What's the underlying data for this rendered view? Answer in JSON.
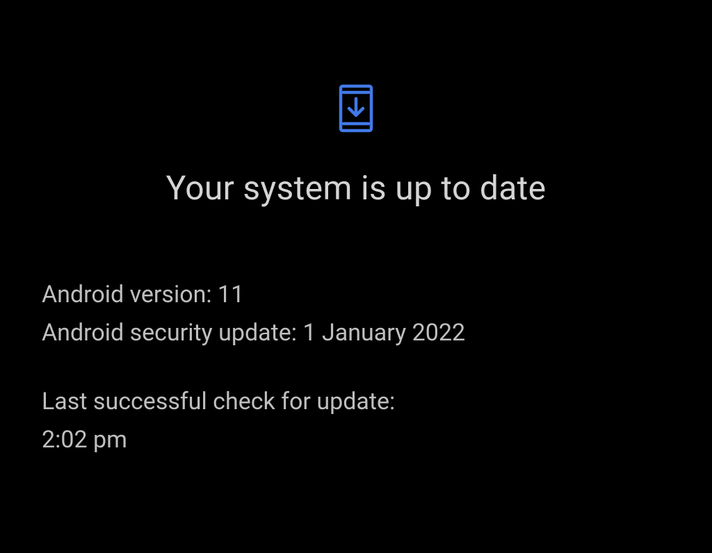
{
  "colors": {
    "accent": "#4179e8",
    "text_primary": "#d4d4d4",
    "text_secondary": "#bfbfbf",
    "background": "#000000"
  },
  "header": {
    "title": "Your system is up to date"
  },
  "details": {
    "android_version_label": "Android version: ",
    "android_version_value": "11",
    "security_update_label": "Android security update: ",
    "security_update_value": "1 January 2022",
    "last_check_label": "Last successful check for update:",
    "last_check_value": "2:02 pm"
  }
}
